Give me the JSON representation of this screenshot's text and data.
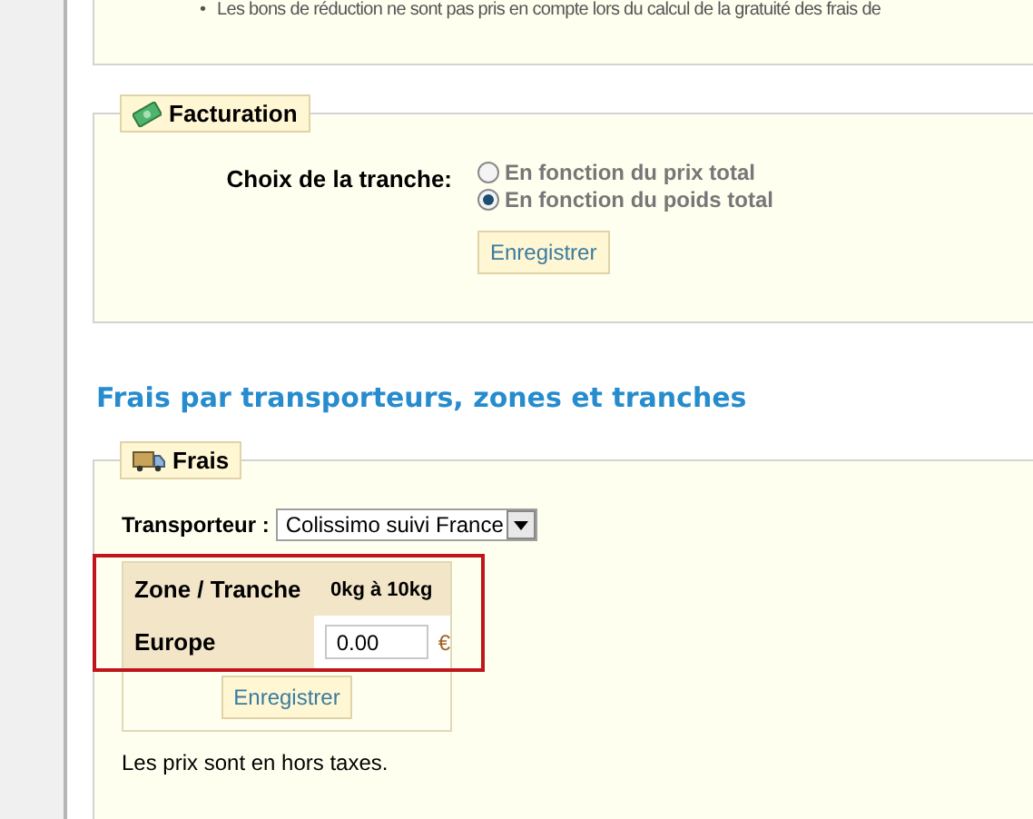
{
  "note_list": [
    {
      "bullet": "•",
      "text": "Les bons de réduction ne sont pas pris en compte lors du calcul de la gratuité des frais de"
    }
  ],
  "billing": {
    "legend": "Facturation",
    "label": "Choix de la tranche:",
    "options": [
      {
        "label": "En fonction du prix total",
        "selected": false
      },
      {
        "label": "En fonction du poids total",
        "selected": true
      }
    ],
    "button": "Enregistrer"
  },
  "section_title": "Frais par transporteurs, zones et tranches",
  "fees": {
    "legend": "Frais",
    "carrier_label": "Transporteur :",
    "carrier_value": "Colissimo suivi France",
    "table": {
      "header": "Zone / Tranche",
      "ranges": [
        "0kg à 10kg"
      ],
      "rows": [
        {
          "zone": "Europe",
          "values": [
            "0.00"
          ],
          "currency": "€"
        }
      ]
    },
    "highlighted": true,
    "button": "Enregistrer",
    "footnote": "Les prix sont en hors taxes."
  }
}
